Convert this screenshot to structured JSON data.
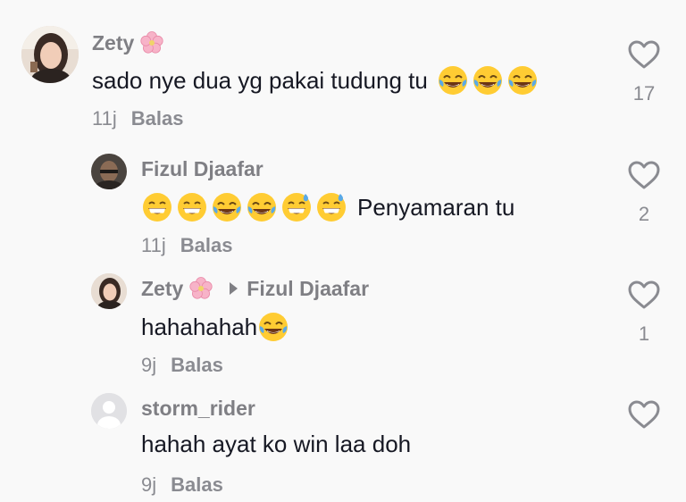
{
  "comments": [
    {
      "author": "Zety",
      "author_badge": "cherry-blossom-emoji",
      "text": "sado nye dua yg pakai tudung tu",
      "emojis": [
        "joy",
        "joy",
        "joy"
      ],
      "time": "11j",
      "reply_label": "Balas",
      "likes": "17"
    },
    {
      "author": "Fizul Djaafar",
      "emojis_before": [
        "grin",
        "grin",
        "joy",
        "joy",
        "sweat-smile",
        "sweat-smile"
      ],
      "text": "Penyamaran tu",
      "time": "11j",
      "reply_label": "Balas",
      "likes": "2"
    },
    {
      "author": "Zety",
      "author_badge": "cherry-blossom-emoji",
      "reply_to": "Fizul Djaafar",
      "text": "hahahahah",
      "emojis": [
        "joy"
      ],
      "time": "9j",
      "reply_label": "Balas",
      "likes": "1"
    },
    {
      "author": "storm_rider",
      "text": "hahah ayat ko win laa doh",
      "time": "9j",
      "reply_label": "Balas",
      "likes": ""
    }
  ],
  "colors": {
    "background": "#f9f9f9",
    "text": "#161823",
    "muted": "#8a8b91",
    "username": "#7f7f84"
  }
}
